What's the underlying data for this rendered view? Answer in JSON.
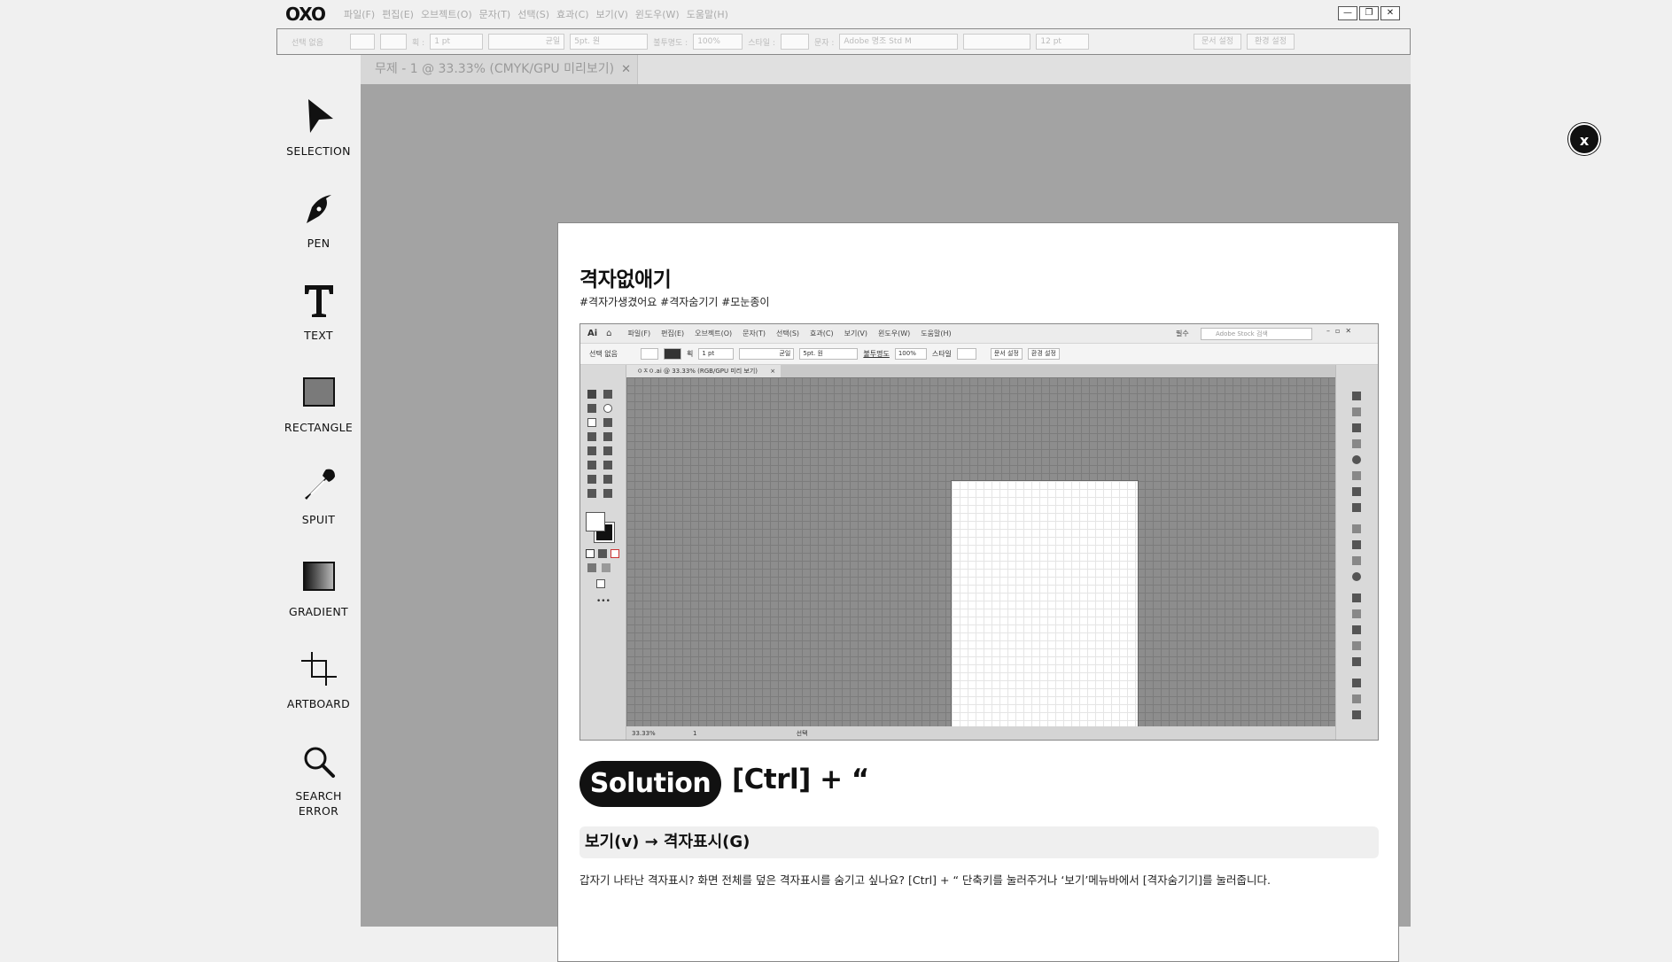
{
  "app": {
    "logo": "OXO",
    "menu": [
      "파일(F)",
      "편집(E)",
      "오브젝트(O)",
      "문자(T)",
      "선택(S)",
      "효과(C)",
      "보기(V)",
      "윈도우(W)",
      "도움말(H)"
    ],
    "window_controls": [
      "—",
      "❐",
      "✕"
    ]
  },
  "controlbar": {
    "selection": "선택 없음",
    "stroke_label": "획 :",
    "stroke_value": "1 pt",
    "line_style": "균일",
    "brush": "5pt. 원",
    "opacity_label": "불투명도 :",
    "opacity_value": "100%",
    "style_label": "스타일 :",
    "font_label": "문자 :",
    "font_value": "Adobe 명조 Std M",
    "font_size": "12 pt",
    "doc_settings": "문서 설정",
    "prefs": "환경 설정"
  },
  "tools": [
    {
      "label": "SELECTION",
      "icon": "arrow-cursor-icon"
    },
    {
      "label": "PEN",
      "icon": "pen-nib-icon"
    },
    {
      "label": "TEXT",
      "icon": "text-t-icon"
    },
    {
      "label": "RECTANGLE",
      "icon": "rectangle-icon"
    },
    {
      "label": "SPUIT",
      "icon": "eyedropper-icon"
    },
    {
      "label": "GRADIENT",
      "icon": "gradient-square-icon"
    },
    {
      "label": "ARTBOARD",
      "icon": "artboard-crop-icon"
    },
    {
      "label": "SEARCH\nERROR",
      "icon": "magnifier-icon"
    }
  ],
  "document_tab": {
    "label": "무제 - 1 @ 33.33% (CMYK/GPU 미리보기)",
    "close": "✕"
  },
  "modal": {
    "close": "x",
    "title": "격자없애기",
    "tags": "#격자가생겼어요 #격자숨기기 #모눈종이",
    "screenshot": {
      "app_badge": "Ai",
      "menu": [
        "파일(F)",
        "편집(E)",
        "오브젝트(O)",
        "문자(T)",
        "선택(S)",
        "효과(C)",
        "보기(V)",
        "윈도우(W)",
        "도움말(H)"
      ],
      "workspace": "필수",
      "stock_search": "Adobe Stock 검색",
      "control": {
        "selection": "선택 없음",
        "stroke_label": "획",
        "stroke_value": "1 pt",
        "line_style": "균일",
        "brush": "5pt. 원",
        "opacity_label": "불투명도",
        "opacity_value": "100%",
        "style_label": "스타일",
        "doc_settings": "문서 설정",
        "prefs": "환경 설정"
      },
      "tab": "ㅇㅈㅇ.ai @ 33.33% (RGB/GPU 미리 보기)",
      "tab_close": "×",
      "zoom": "33.33%",
      "page": "1",
      "status": "선택"
    },
    "solution_label": "Solution",
    "shortcut": "[Ctrl]  +  “",
    "menu_path": "보기(v) → 격자표시(G)",
    "description": "갑자기 나타난 격자표시? 화면 전체를 덮은 격자표시를 숨기고 싶나요? [Ctrl] + “ 단축키를 눌러주거나 ‘보기’메뉴바에서 [격자숨기기]를 눌러줍니다."
  }
}
